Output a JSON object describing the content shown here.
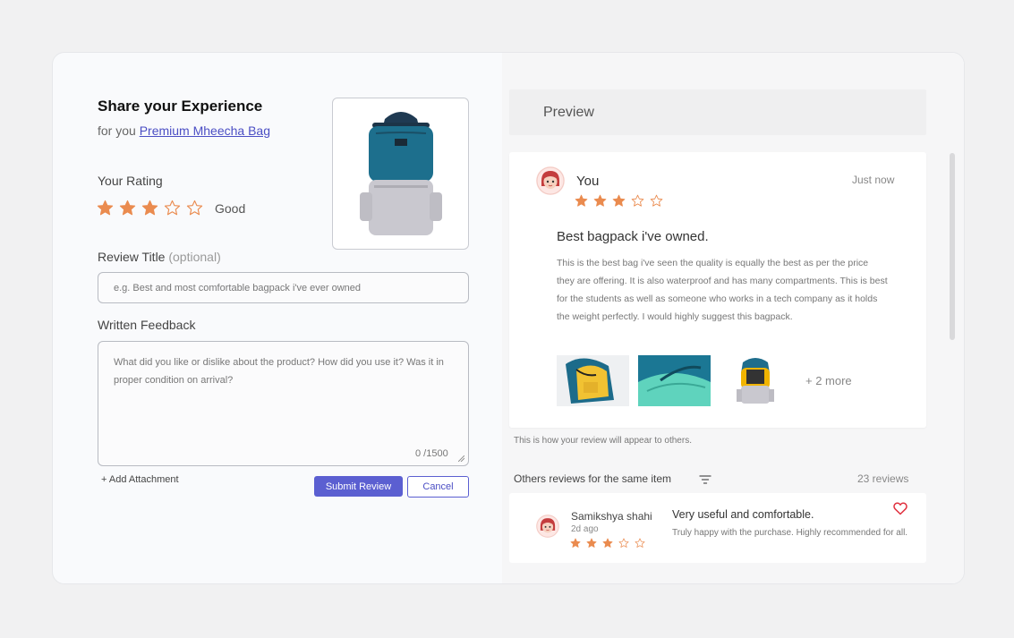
{
  "form": {
    "title": "Share your Experience",
    "for_prefix": "for you",
    "product_link": "Premium Mheecha Bag",
    "rating_label": "Your Rating",
    "rating_value": 3,
    "rating_max": 5,
    "rating_word": "Good",
    "review_title_label": "Review Title",
    "review_title_optional": "(optional)",
    "review_title_placeholder": "e.g. Best and most comfortable bagpack i've ever owned",
    "feedback_label": "Written Feedback",
    "feedback_placeholder": "What did you like or dislike about the product? How did you use it? Was it in proper condition on arrival?",
    "char_counter": "0 /1500",
    "add_attachment": "+ Add Attachment",
    "submit_label": "Submit Review",
    "cancel_label": "Cancel"
  },
  "preview": {
    "header": "Preview",
    "author": "You",
    "time": "Just now",
    "rating": 3,
    "title": "Best bagpack i've owned.",
    "body": "This is the best bag i've seen the quality is equally the best as per the price they are offering. It is also waterproof and has many compartments. This is best for the students as well as someone who works in a tech company as it holds the weight perfectly. I would highly suggest this bagpack.",
    "more_images": "+ 2 more",
    "note": "This is how your review will appear to others."
  },
  "others": {
    "heading": "Others reviews for the same item",
    "count": "23 reviews",
    "reviews": [
      {
        "author": "Samikshya shahi",
        "time": "2d ago",
        "rating": 3,
        "title": "Very useful and comfortable.",
        "body": "Truly happy with the purchase. Highly recommended for all."
      }
    ]
  },
  "colors": {
    "accent": "#5b5fd1",
    "star": "#ea8b4f",
    "heart": "#e0313f"
  },
  "icons": [
    "star-icon",
    "star-outline-icon",
    "filter-icon",
    "heart-icon",
    "avatar"
  ]
}
